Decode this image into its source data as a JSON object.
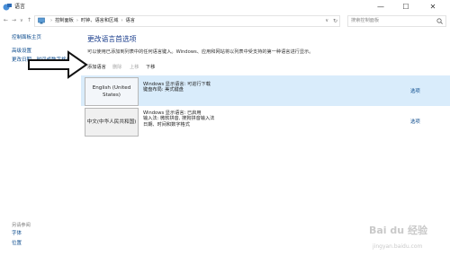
{
  "window": {
    "title": "语言",
    "minimize_glyph": "—",
    "maximize_glyph": "☐",
    "close_glyph": "✕"
  },
  "nav": {
    "back_glyph": "←",
    "forward_glyph": "→",
    "dropdown_glyph": "∨",
    "up_glyph": "↑",
    "breadcrumb": [
      "控制面板",
      "时钟、语言和区域",
      "语言"
    ],
    "breadcrumb_separator": "›",
    "search_placeholder": "搜索控制面板"
  },
  "sidebar": {
    "home": "控制面板主页",
    "advanced": "高级设置",
    "date_format": "更改日期、时间或数字格式",
    "see_also_title": "另请参阅",
    "fonts": "字体",
    "location": "位置"
  },
  "main": {
    "heading": "更改语言首选项",
    "description": "可以使用已添加到列表中的任何语言键入。Windows、应用和网站将以列表中受支持的第一种语言进行显示。",
    "toolbar": {
      "add": "添加语言",
      "remove": "删除",
      "move_up": "上移",
      "move_down": "下移"
    },
    "languages": [
      {
        "name": "English (United States)",
        "display": "Windows 显示语言: 可进行下载",
        "layout": "键盘布局: 美式键盘",
        "extra": "",
        "options": "选项"
      },
      {
        "name": "中文(中华人民共和国)",
        "display": "Windows 显示语言: 已启用",
        "layout": "输入法: 微软拼音, 搜狗拼音输入法",
        "extra": "日期、时间和数字格式",
        "options": "选项"
      }
    ]
  },
  "watermark": {
    "logo": "Bai du 经验",
    "url": "jingyan.baidu.com"
  },
  "colors": {
    "link": "#0a4a8c",
    "heading": "#1a3d8c",
    "selected_row": "#d9ecfb"
  }
}
